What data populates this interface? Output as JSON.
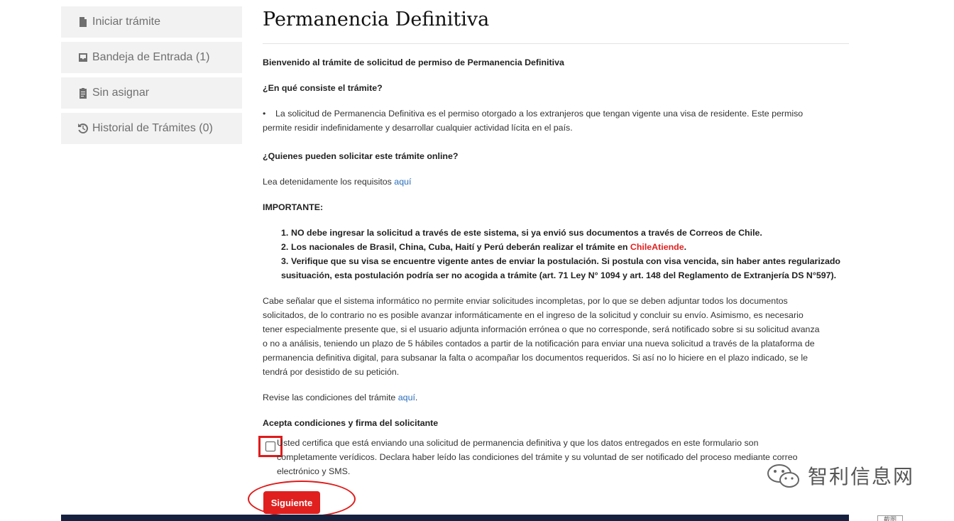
{
  "sidebar": {
    "items": [
      {
        "label": "Iniciar trámite",
        "icon": "file-icon"
      },
      {
        "label": "Bandeja de Entrada (1)",
        "icon": "inbox-icon"
      },
      {
        "label": "Sin asignar",
        "icon": "clipboard-icon"
      },
      {
        "label": "Historial de Trámites (0)",
        "icon": "history-icon"
      }
    ]
  },
  "main": {
    "title": "Permanencia Definitiva",
    "welcome": "Bienvenido al trámite de solicitud de permiso de Permanencia Definitiva",
    "q1": "¿En qué consiste el trámite?",
    "bullet_line1": "La solicitud de Permanencia Definitiva es el permiso otorgado a los extranjeros que tengan vigente una visa de residente. Este permiso",
    "bullet_line2": "permite residir indefinidamente y desarrollar cualquier actividad lícita en el país.",
    "q2": "¿Quienes pueden solicitar este trámite online?",
    "requirements_text": "Lea detenidamente los requisitos ",
    "requirements_link": "aquí",
    "important": "IMPORTANTE:",
    "list": {
      "item1": "NO debe ingresar la solicitud a través de este sistema, si ya envió sus documentos a través de Correos de Chile.",
      "item2_pre": "Los nacionales de Brasil, China, Cuba, Haití y Perú deberán realizar el trámite en ",
      "item2_link": "ChileAtiende",
      "item2_post": ".",
      "item3_line1": "Verifique que su visa se encuentre vigente antes de enviar la postulación. Si postula con visa vencida, sin haber antes regularizado su",
      "item3_line2": "situación, esta postulación podría ser no acogida a trámite (art. 71 Ley N° 1094 y art. 148 del Reglamento de Extranjería DS N°597)."
    },
    "paragraph_lines": [
      "Cabe señalar que el sistema informático no permite enviar solicitudes incompletas, por lo que se deben adjuntar todos los documentos",
      "solicitados, de lo contrario no es posible avanzar informáticamente en el ingreso de la solicitud y concluir su envío. Asimismo, es necesario",
      "tener especialmente presente que, si el usuario adjunta información errónea o que no corresponde, será notificado sobre si su solicitud avanza",
      "o no a análisis, teniendo un plazo de 5 hábiles contados a partir de la notificación para enviar una nueva solicitud a través de la plataforma de",
      "permanencia definitiva digital, para subsanar la falta o acompañar los documentos requeridos. Si así no lo hiciere en el plazo indicado, se le",
      "tendrá por desistido de su petición."
    ],
    "conditions_text": "Revise las condiciones del trámite ",
    "conditions_link": "aquí",
    "conditions_post": ".",
    "accept_heading": "Acepta condiciones y firma del solicitante",
    "certify_lines": [
      "Usted certifica que está enviando una solicitud de permanencia definitiva y que los datos entregados en este formulario son",
      "completamente verídicos. Declara haber leído las condiciones del trámite y su voluntad de ser notificado del proceso mediante correo",
      "electrónico y SMS."
    ],
    "next_button": "Siguiente"
  },
  "watermark": "智利信息网",
  "corner_tag": "截图",
  "colors": {
    "accent_red": "#e0201f",
    "link_blue": "#2a6ebb",
    "footer": "#15213f",
    "sidebar_bg": "#f2f2f2"
  }
}
